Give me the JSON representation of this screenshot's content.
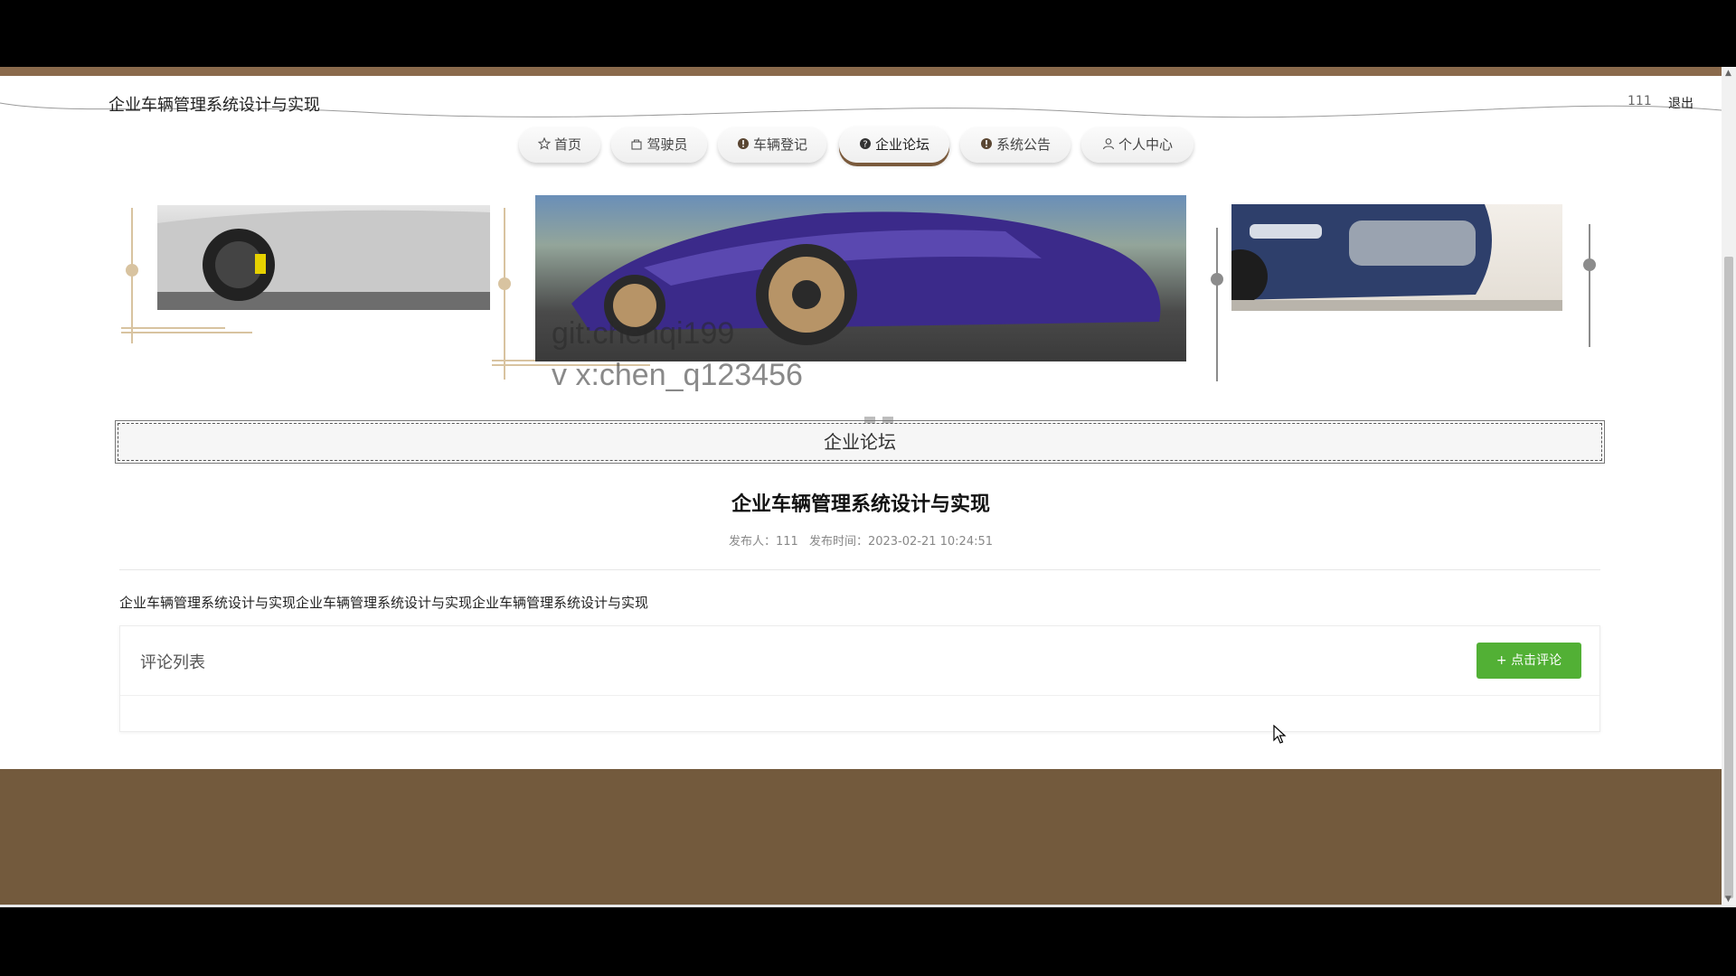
{
  "header": {
    "site_title": "企业车辆管理系统设计与实现",
    "user_name": "111",
    "logout_label": "退出"
  },
  "nav": {
    "items": [
      {
        "label": "首页",
        "icon": "star-icon"
      },
      {
        "label": "驾驶员",
        "icon": "bag-icon"
      },
      {
        "label": "车辆登记",
        "icon": "exclamation-icon"
      },
      {
        "label": "企业论坛",
        "icon": "question-icon",
        "active": true
      },
      {
        "label": "系统公告",
        "icon": "info-icon"
      },
      {
        "label": "个人中心",
        "icon": "user-icon"
      }
    ]
  },
  "carousel": {
    "watermark_line1": "git:chenqi199",
    "watermark_line2": "v x:chen_q123456",
    "slide_count": 3,
    "active_index": 2
  },
  "section": {
    "title": "企业论坛"
  },
  "post": {
    "title": "企业车辆管理系统设计与实现",
    "publisher_label": "发布人：111",
    "time_label": "发布时间：2023-02-21 10:24:51",
    "body": "企业车辆管理系统设计与实现企业车辆管理系统设计与实现企业车辆管理系统设计与实现"
  },
  "comments": {
    "title": "评论列表",
    "button_label": "+ 点击评论"
  },
  "colors": {
    "brand_brown": "#735a3d",
    "accent_green": "#52b035",
    "deco_gold": "#d8c3a0"
  }
}
